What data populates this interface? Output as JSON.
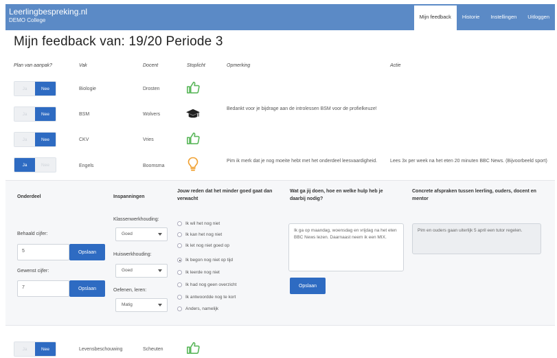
{
  "header": {
    "brand": "Leerlingbespreking.nl",
    "school": "DEMO College",
    "nav": [
      {
        "label": "Mijn feedback",
        "active": true
      },
      {
        "label": "Historie",
        "active": false
      },
      {
        "label": "Instellingen",
        "active": false
      },
      {
        "label": "Uitloggen",
        "active": false
      }
    ]
  },
  "page": {
    "title": "Mijn feedback van: 19/20 Periode 3"
  },
  "table": {
    "headers": {
      "plan": "Plan van aanpak?",
      "vak": "Vak",
      "docent": "Docent",
      "stoplicht": "Stoplicht",
      "opmerking": "Opmerking",
      "actie": "Actie"
    },
    "toggle": {
      "ja": "Ja",
      "nee": "Nee"
    },
    "rows": [
      {
        "plan": "Nee",
        "vak": "Biologie",
        "docent": "Drosten",
        "icon": "thumbs-up-icon",
        "opmerking": "",
        "actie": ""
      },
      {
        "plan": "Nee",
        "vak": "BSM",
        "docent": "Wolvers",
        "icon": "graduation-cap-icon",
        "opmerking": "Bedankt voor je bijdrage aan de introlessen BSM voor de profielkeuze!",
        "actie": ""
      },
      {
        "plan": "Nee",
        "vak": "CKV",
        "docent": "Vries",
        "icon": "thumbs-up-icon",
        "opmerking": "",
        "actie": ""
      },
      {
        "plan": "Ja",
        "vak": "Engels",
        "docent": "Boomsma",
        "icon": "lightbulb-icon",
        "opmerking": "Pim ik merk dat je nog moeite hebt met het onderdeel leesvaardigheid.",
        "actie": "Lees 3x per week na het eten 20 minuten BBC News. (Bijvoorbeeld sport)"
      }
    ],
    "last_row": {
      "plan": "Nee",
      "vak": "Levensbeschouwing",
      "docent": "Scheuten",
      "icon": "thumbs-up-icon"
    }
  },
  "detail": {
    "headers": {
      "onderdeel": "Onderdeel",
      "inspanningen": "Inspanningen",
      "reden": "Jouw reden dat het minder goed gaat dan verwacht",
      "hulp": "Wat ga jij doen, hoe en welke hulp heb je daarbij nodig?",
      "afspraken": "Concrete afspraken tussen leerling, ouders, docent en mentor"
    },
    "behaald_label": "Behaald cijfer:",
    "behaald_value": "5",
    "gewenst_label": "Gewenst cijfer:",
    "gewenst_value": "7",
    "opslaan": "Opslaan",
    "klassenwerkhouding_label": "Klassenwerkhouding:",
    "klassenwerkhouding_value": "Goed",
    "huiswerkhouding_label": "Huiswerkhouding:",
    "huiswerkhouding_value": "Goed",
    "oefenen_label": "Oefenen, leren:",
    "oefenen_value": "Matig",
    "reasons": [
      {
        "label": "Ik wil het nog niet",
        "checked": false
      },
      {
        "label": "Ik kan het nog niet",
        "checked": false
      },
      {
        "label": "Ik let nog niet goed op",
        "checked": false
      },
      {
        "label": "Ik begon nog niet op tijd",
        "checked": true
      },
      {
        "label": "Ik leerde nog niet",
        "checked": false
      },
      {
        "label": "Ik had nog geen overzicht",
        "checked": false
      },
      {
        "label": "Ik antwoordde nog te kort",
        "checked": false
      },
      {
        "label": "Anders, namelijk",
        "checked": false
      }
    ],
    "hulp_text": "Ik ga op maandag, woensdag en vrijdag na het eten BBC News lezen. Daarnaast neem ik een MIX.",
    "afspraken_text": "Pim en ouders gaan uiterlijk 5 april een tutor regelen."
  },
  "colors": {
    "header": "#5b8ac6",
    "primary": "#2e6bc2",
    "thumb": "#5cb85c",
    "bulb": "#f0a030"
  }
}
